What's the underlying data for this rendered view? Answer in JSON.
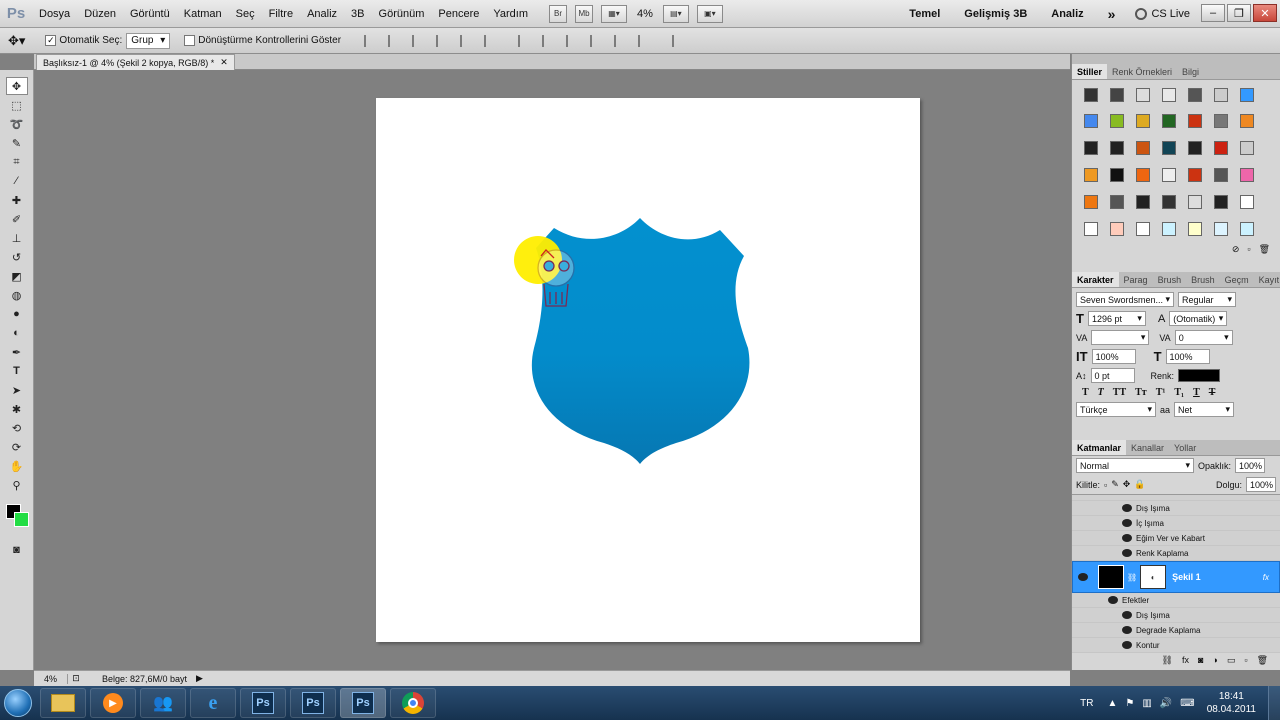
{
  "app": {
    "logo": "Ps"
  },
  "menu": [
    "Dosya",
    "Düzen",
    "Görüntü",
    "Katman",
    "Seç",
    "Filtre",
    "Analiz",
    "3B",
    "Görünüm",
    "Pencere",
    "Yardım"
  ],
  "menubar": {
    "br_label": "Br",
    "mb_label": "Mb",
    "zoom": "4%",
    "workspaces": [
      "Temel",
      "Gelişmiş 3B",
      "Analiz"
    ],
    "more": "»",
    "cs_live": "CS Live"
  },
  "options": {
    "auto_select_label": "Otomatik Seç:",
    "auto_select_value": "Grup",
    "transform_label": "Dönüştürme Kontrollerini Göster"
  },
  "document": {
    "tab_title": "Başlıksız-1 @ 4% (Şekil 2 kopya, RGB/8) *"
  },
  "status": {
    "zoom": "4%",
    "doc_info": "Belge: 827,6M/0 bayt"
  },
  "swatch_panel": {
    "tabs": [
      "Stiller",
      "Renk Örnekleri",
      "Bilgi"
    ],
    "colors": [
      "#333333",
      "#444444",
      "#dddddd",
      "#e8e8e8",
      "#555555",
      "#cccccc",
      "#3399ff",
      "#4488ee",
      "#88bb22",
      "#ddaa22",
      "#226622",
      "#cc3311",
      "#777777",
      "#ee8822",
      "#222222",
      "#222222",
      "#cc5511",
      "#114455",
      "#222222",
      "#cc2211",
      "#cccccc",
      "#ee9922",
      "#111111",
      "#ee6611",
      "#eeeeee",
      "#cc3311",
      "#555555",
      "#ee66aa",
      "#ee7711",
      "#555555",
      "#222222",
      "#333333",
      "#dddddd",
      "#222222",
      "#ffffff",
      "#ffffff",
      "#ffccbb",
      "#ffffff",
      "#ccf2ff",
      "#ffffcc",
      "#ddf4ff",
      "#ccf2ff"
    ]
  },
  "character_panel": {
    "tabs": [
      "Karakter",
      "Parag",
      "Brush",
      "Brush",
      "Geçm",
      "Kayıt"
    ],
    "font_family": "Seven Swordsmen...",
    "font_style": "Regular",
    "font_size": "1296 pt",
    "leading": "(Otomatik)",
    "kerning": "",
    "tracking": "0",
    "vertical_scale": "100%",
    "horizontal_scale": "100%",
    "baseline_shift": "0 pt",
    "color_label": "Renk:",
    "language": "Türkçe",
    "antialias_label": "aa",
    "antialias": "Net"
  },
  "layers_panel": {
    "tabs": [
      "Katmanlar",
      "Kanallar",
      "Yollar"
    ],
    "blend_mode": "Normal",
    "opacity_label": "Opaklık:",
    "opacity": "100%",
    "lock_label": "Kilitle:",
    "fill_label": "Dolgu:",
    "fill": "100%",
    "effects_top": [
      "Dış Işıma",
      "İç Işıma",
      "Eğim Ver ve Kabart",
      "Renk Kaplama"
    ],
    "selected_layer": "Şekil 1",
    "effects_label": "Efektler",
    "effects_bottom": [
      "Dış Işıma",
      "Degrade Kaplama",
      "Kontur"
    ]
  },
  "taskbar": {
    "ps_label": "Ps",
    "language": "TR",
    "time": "18:41",
    "date": "08.04.2011"
  },
  "colors": {
    "accent_blue": "#3399ff",
    "shield_top": "#0390cf",
    "shield_bottom": "#0677b2",
    "fg": "#000000",
    "bg": "#22dd44"
  }
}
